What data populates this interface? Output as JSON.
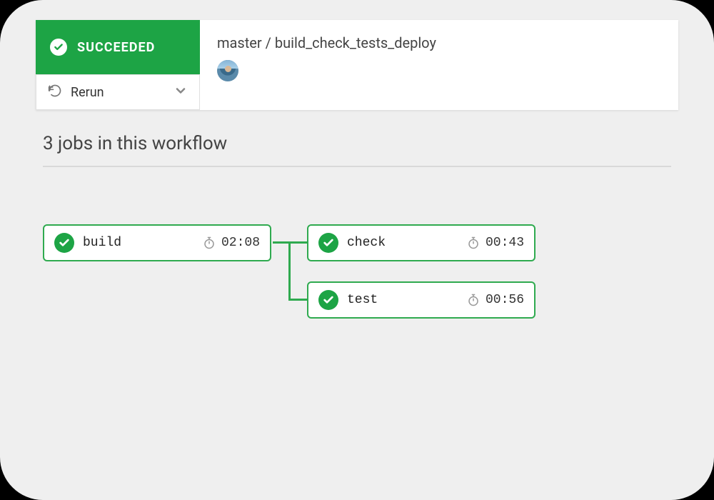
{
  "colors": {
    "success": "#1da445",
    "node_border": "#2faa4f",
    "page_bg": "#efefef"
  },
  "header": {
    "status_label": "SUCCEEDED",
    "rerun_label": "Rerun",
    "breadcrumb": "master / build_check_tests_deploy"
  },
  "section": {
    "heading": "3 jobs in this workflow"
  },
  "jobs": {
    "build": {
      "name": "build",
      "duration": "02:08",
      "status": "succeeded"
    },
    "check": {
      "name": "check",
      "duration": "00:43",
      "status": "succeeded"
    },
    "test": {
      "name": "test",
      "duration": "00:56",
      "status": "succeeded"
    }
  },
  "icons": {
    "check_circle": "check-circle-icon",
    "refresh": "refresh-icon",
    "chevron_down": "chevron-down-icon",
    "stopwatch": "stopwatch-icon"
  }
}
